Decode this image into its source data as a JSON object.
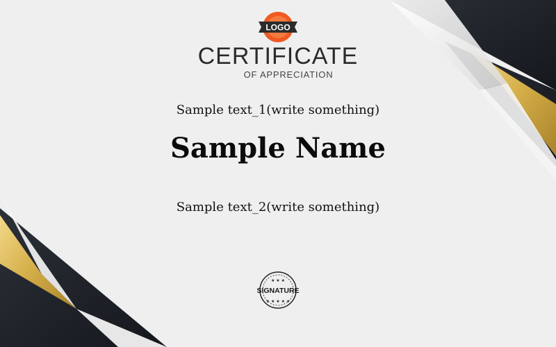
{
  "certificate": {
    "logo_text": "LOGO",
    "title": "CERTIFICATE",
    "subtitle": "OF APPRECIATION",
    "text_1": "Sample text_1(write something)",
    "name": "Sample Name",
    "text_2": "Sample text_2(write something)",
    "signature_text": "SIGNATURE"
  },
  "colors": {
    "background": "#efefef",
    "dark_band": "#1e2127",
    "gold": "#d4ae48",
    "logo_orange": "#f05a22",
    "logo_ribbon": "#2b2b2b"
  },
  "icons": {
    "logo": "logo-badge-icon",
    "seal": "signature-seal-icon"
  }
}
